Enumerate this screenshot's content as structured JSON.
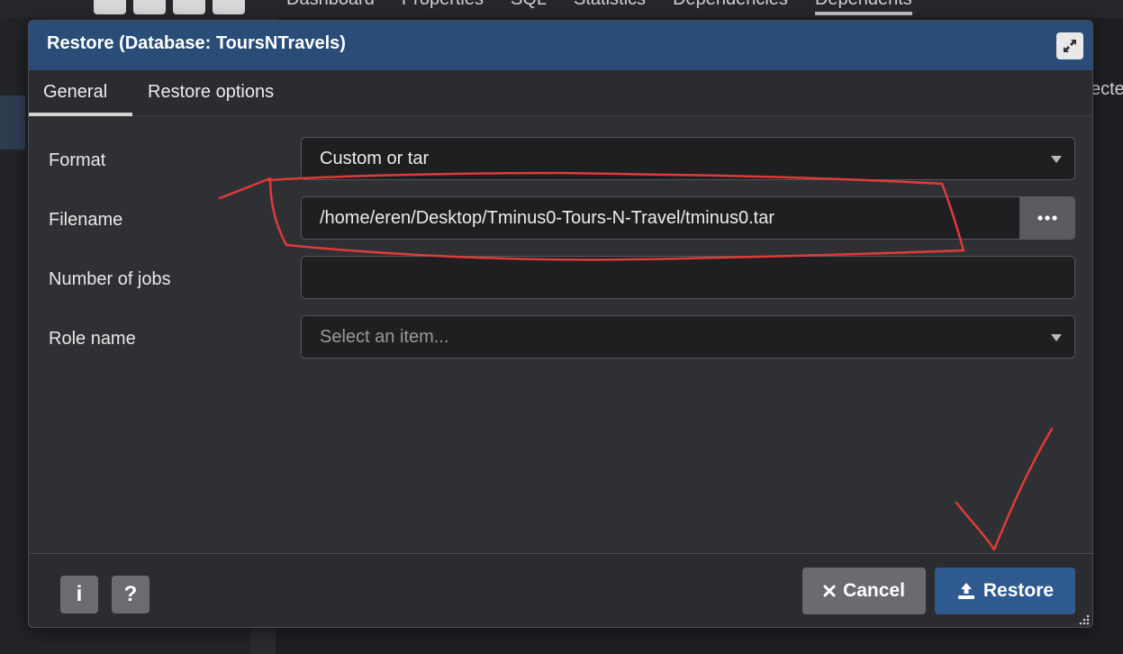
{
  "background": {
    "tabs": [
      "Dashboard",
      "Properties",
      "SQL",
      "Statistics",
      "Dependencies",
      "Dependents"
    ],
    "right_text": "ecte"
  },
  "dialog": {
    "title": "Restore (Database: ToursNTravels)",
    "tabs": [
      {
        "label": "General"
      },
      {
        "label": "Restore options"
      }
    ],
    "fields": {
      "format": {
        "label": "Format",
        "value": "Custom or tar"
      },
      "filename": {
        "label": "Filename",
        "value": "/home/eren/Desktop/Tminus0-Tours-N-Travel/tminus0.tar"
      },
      "jobs": {
        "label": "Number of jobs",
        "value": ""
      },
      "role": {
        "label": "Role name",
        "placeholder": "Select an item..."
      }
    },
    "footer": {
      "info_label": "i",
      "help_label": "?",
      "cancel_label": "Cancel",
      "restore_label": "Restore"
    }
  },
  "colors": {
    "title_bar": "#2a4d78",
    "restore_button": "#2f5a8f",
    "annotation": "#e03a3a"
  }
}
